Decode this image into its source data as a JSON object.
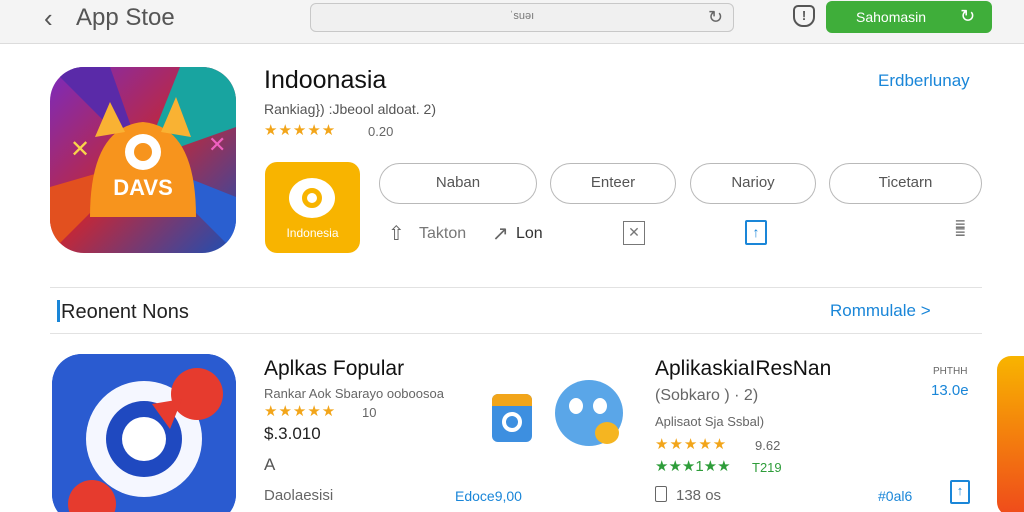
{
  "topbar": {
    "app_title": "App Stoe",
    "search_text": "ˈsuəı",
    "action_button": "Sahomasin"
  },
  "hero": {
    "icon_text": "DAVS",
    "title": "Indoonasia",
    "subtitle": "Rankiag}) :Jbeool aldoat. 2)",
    "stars": "★★★★★",
    "score": "0.20",
    "link": "Erdberlunay",
    "small_app_label": "Indonesia",
    "pills": [
      "Naban",
      "Enteer",
      "Narioy",
      "Ticetarn"
    ],
    "actions": {
      "share_label": "Takton",
      "lon_label": "Lon"
    }
  },
  "section": {
    "title": "Reonent Nons",
    "link": "Rommulale >"
  },
  "row1": {
    "title": "Aplkas Fopular",
    "sub": "Rankar Aok Sbarayo ooboosoa",
    "stars": "★★★★★",
    "rating": "10",
    "price": "$.3.010",
    "letter": "A",
    "footer": "Daolaesisi",
    "link": "Edoce9,00"
  },
  "row2": {
    "title": "AplikaskiaIResNan",
    "sub1": "(Sobkaro ) · 2)",
    "sub2": "Aplisaot Sja Ssbal)",
    "stars": "★★★★★",
    "rating": "9.62",
    "stars2": "★★★1★★",
    "rating2": "T219",
    "count": "138 os",
    "price_label": "PHTHH",
    "price": "13.0e",
    "link": "#0al6"
  },
  "colors": {
    "accent": "#1a86d8",
    "green": "#3fae3a",
    "star": "#f2a51a"
  }
}
